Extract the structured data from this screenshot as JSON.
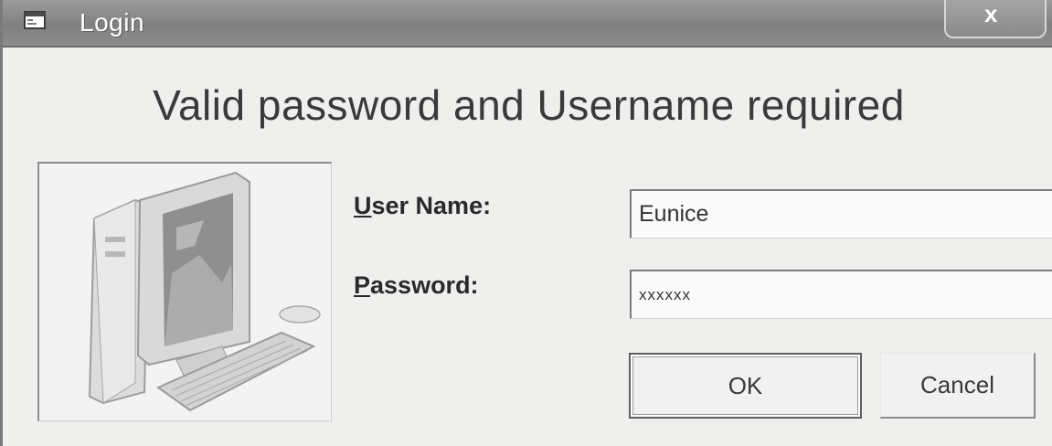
{
  "window": {
    "title": "Login",
    "close_symbol": "x"
  },
  "form": {
    "heading": "Valid password and Username required",
    "username_label": "User Name:",
    "username_label_rest": "ser Name:",
    "username_accesskey": "U",
    "username_value": "Eunice",
    "password_label": "Password:",
    "password_label_rest": "assword:",
    "password_accesskey": "P",
    "password_masked": "xxxxxx"
  },
  "buttons": {
    "ok_label": "OK",
    "cancel_label": "Cancel"
  },
  "icons": {
    "title": "window-app-icon",
    "illustration": "desktop-computer-illustration"
  }
}
